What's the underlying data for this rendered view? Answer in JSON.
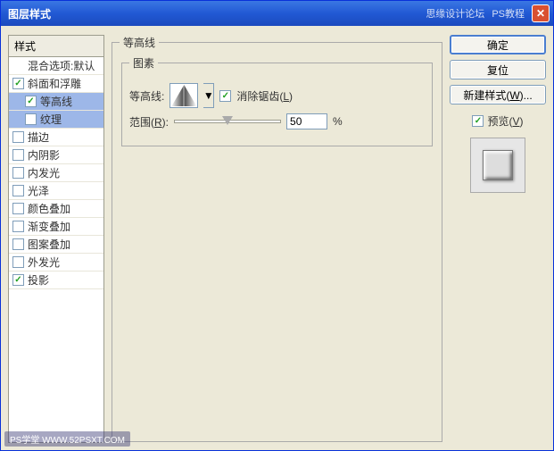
{
  "title": "图层样式",
  "titlebar_right": {
    "text1": "思缘设计论坛",
    "text2": "PS教程"
  },
  "styles_header": "样式",
  "styles": {
    "blend_default": "混合选项:默认",
    "bevel": "斜面和浮雕",
    "contour": "等高线",
    "texture": "纹理",
    "stroke": "描边",
    "inner_shadow": "内阴影",
    "inner_glow": "内发光",
    "satin": "光泽",
    "color_overlay": "颜色叠加",
    "gradient_overlay": "渐变叠加",
    "pattern_overlay": "图案叠加",
    "outer_glow": "外发光",
    "drop_shadow": "投影"
  },
  "panel": {
    "outer_legend": "等高线",
    "inner_legend": "图素",
    "contour_label": "等高线:",
    "anti_alias": "消除锯齿(",
    "anti_alias_u": "L",
    "anti_alias_end": ")",
    "range_label": "范围(",
    "range_u": "R",
    "range_end": "):",
    "range_value": "50",
    "range_unit": "%"
  },
  "buttons": {
    "ok": "确定",
    "reset": "复位",
    "new_style": "新建样式(",
    "new_style_u": "W",
    "new_style_end": ")...",
    "preview": "预览(",
    "preview_u": "V",
    "preview_end": ")"
  },
  "watermark": "PS学堂  WWW.52PSXT.COM"
}
